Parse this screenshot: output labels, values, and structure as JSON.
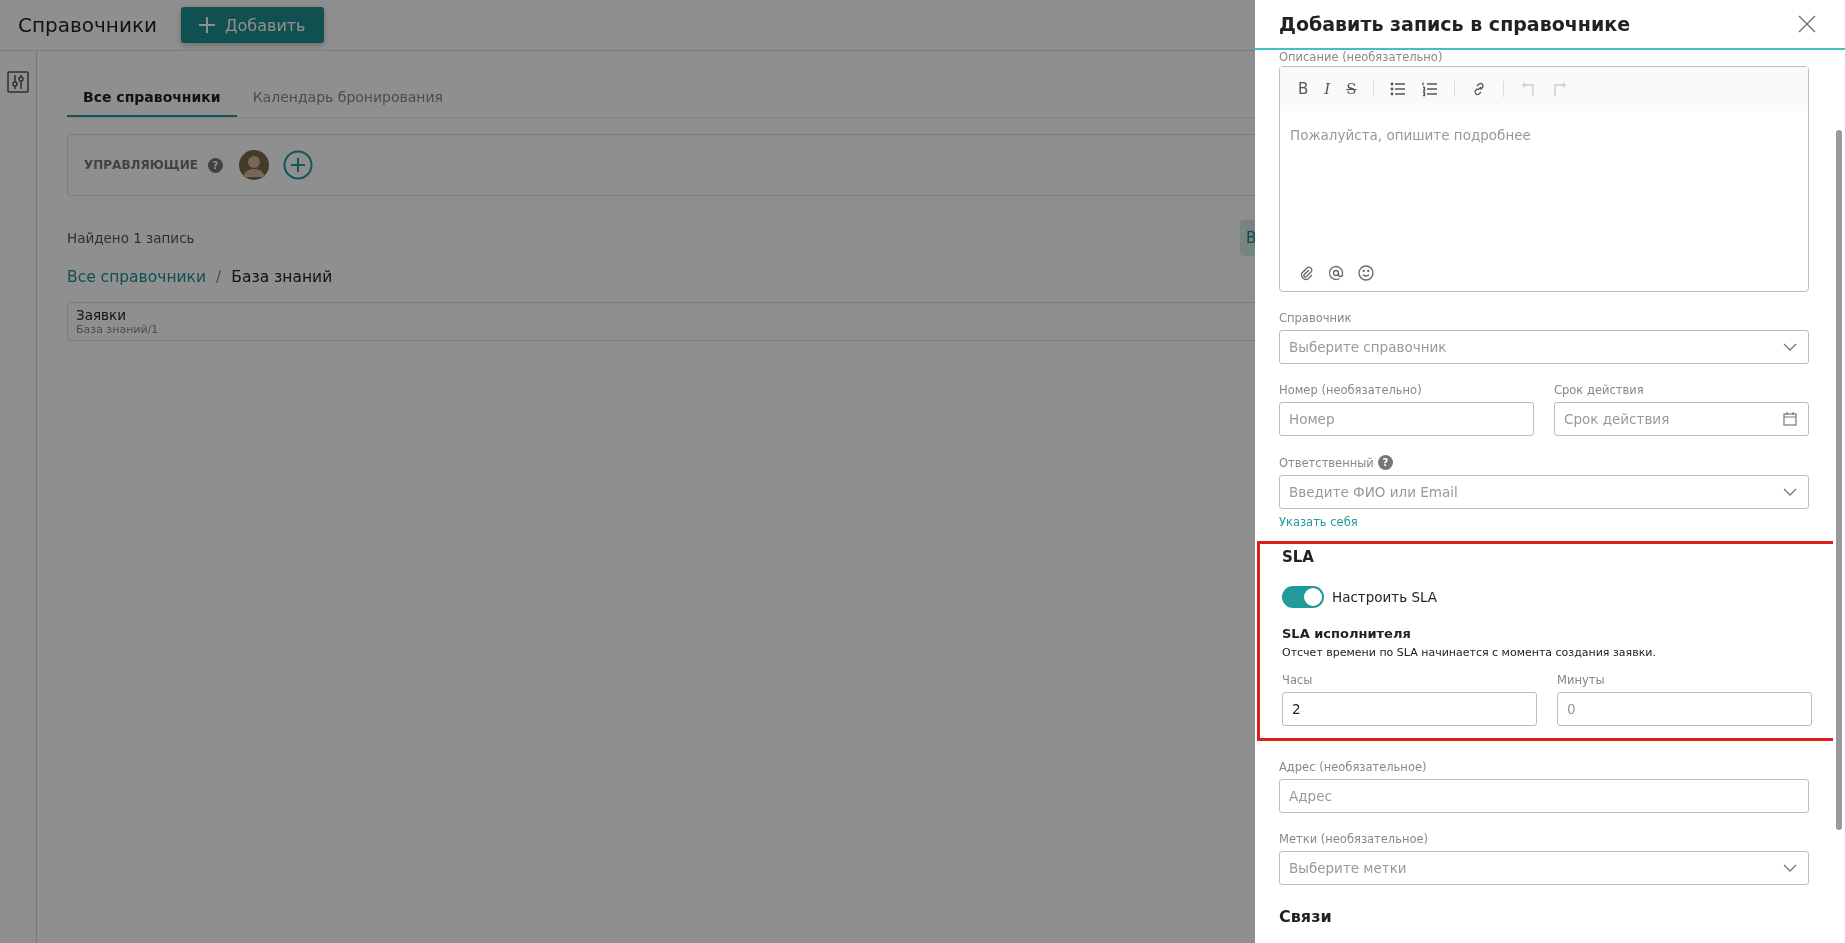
{
  "page": {
    "title": "Справочники",
    "add_button": "Добавить",
    "tabs": [
      {
        "label": "Все справочники",
        "selected": true
      },
      {
        "label": "Календарь бронирования",
        "selected": false
      }
    ],
    "managers": {
      "label": "УПРАВЛЯЮЩИЕ",
      "help": "?"
    },
    "found": "Найдено 1 запись",
    "side_button": "В",
    "breadcrumbs": [
      {
        "label": "Все справочники",
        "link": true
      },
      {
        "label": "База знаний",
        "link": false
      }
    ],
    "breadcrumb_separator": "/",
    "records": [
      {
        "title": "Заявки",
        "subtitle": "База знаний/1"
      }
    ]
  },
  "panel": {
    "title": "Добавить запись в справочнике",
    "description": {
      "label": "Описание (необязательно)",
      "placeholder": "Пожалуйста, опишите подробнее",
      "toolbar": [
        [
          {
            "kind": "bold",
            "glyph": "B",
            "disabled": false
          },
          {
            "kind": "italic",
            "glyph": "I",
            "disabled": false
          },
          {
            "kind": "strike",
            "glyph": "S",
            "disabled": false
          }
        ],
        [
          {
            "kind": "bullets",
            "disabled": false
          },
          {
            "kind": "numbers",
            "disabled": false
          }
        ],
        [
          {
            "kind": "link",
            "disabled": false
          }
        ],
        [
          {
            "kind": "undo",
            "disabled": true
          },
          {
            "kind": "redo",
            "disabled": true
          }
        ]
      ],
      "footer": [
        {
          "kind": "attach"
        },
        {
          "kind": "mention"
        },
        {
          "kind": "emoji"
        }
      ]
    },
    "rows": [
      [
        {
          "kind": "select",
          "label": "Справочник",
          "placeholder": "Выберите справочник"
        }
      ],
      [
        {
          "kind": "input",
          "label": "Номер (необязательно)",
          "placeholder": "Номер"
        },
        {
          "kind": "date",
          "label": "Срок действия",
          "placeholder": "Срок действия"
        }
      ],
      [
        {
          "kind": "select",
          "label": "Ответственный",
          "help": "?",
          "placeholder": "Введите ФИО или Email",
          "link": "Указать себя"
        }
      ]
    ],
    "sla": {
      "heading": "SLA",
      "highlighted": true,
      "toggle": {
        "label": "Настроить SLA",
        "on": true
      },
      "subheading": "SLA исполнителя",
      "note": "Отсчет времени по SLA начинается с момента создания заявки.",
      "fields": [
        {
          "label": "Часы",
          "value": "2"
        },
        {
          "label": "Минуты",
          "placeholder": "0"
        }
      ]
    },
    "rows_after": [
      [
        {
          "kind": "input",
          "label": "Адрес (необязательное)",
          "placeholder": "Адрес"
        }
      ],
      [
        {
          "kind": "select",
          "label": "Метки (необязательное)",
          "placeholder": "Выберите метки"
        }
      ]
    ],
    "section": "Связи"
  }
}
